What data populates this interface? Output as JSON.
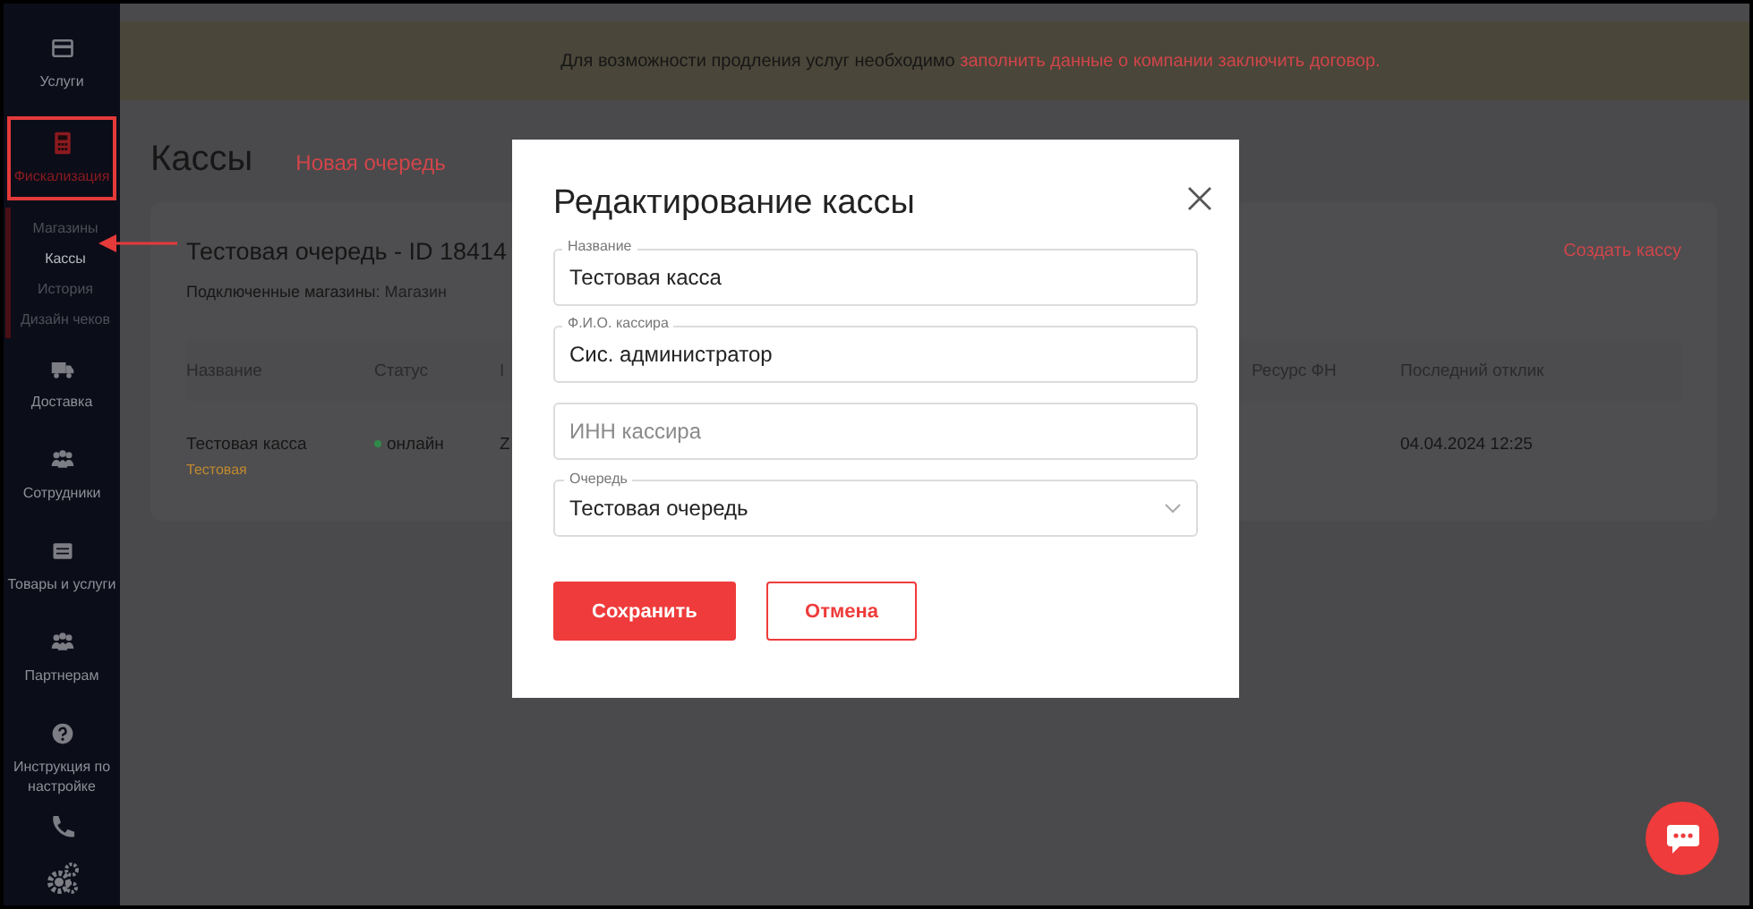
{
  "sidebar": {
    "items": [
      {
        "label": "Услуги",
        "selected": false
      },
      {
        "label": "Фискализация",
        "selected": true,
        "children": [
          {
            "label": "Магазины",
            "selected": false
          },
          {
            "label": "Кассы",
            "selected": true
          },
          {
            "label": "История",
            "selected": false
          },
          {
            "label": "Дизайн чеков",
            "selected": false
          }
        ]
      },
      {
        "label": "Доставка",
        "selected": false
      },
      {
        "label": "Сотрудники",
        "selected": false
      },
      {
        "label": "Товары и услуги",
        "selected": false
      },
      {
        "label": "Партнерам",
        "selected": false
      },
      {
        "label": "Инструкция по настройке",
        "selected": false
      }
    ]
  },
  "banner": {
    "text": "Для возможности продления услуг необходимо ",
    "link": "заполнить данные о компании заключить договор."
  },
  "page": {
    "title": "Кассы",
    "new_queue_link": "Новая очередь"
  },
  "queue": {
    "title": "Тестовая очередь - ID 18414",
    "stores_label": "Подключенные магазины:",
    "stores_value": "Магазин",
    "create_button": "Создать кассу",
    "table": {
      "columns": [
        "Название",
        "Статус",
        "I",
        "Ресурс ФН",
        "Последний отклик"
      ],
      "rows": [
        {
          "name": "Тестовая касса",
          "tag": "Тестовая",
          "status": "онлайн",
          "online": true,
          "column_3": "Z",
          "last_response": "04.04.2024 12:25"
        }
      ]
    }
  },
  "modal": {
    "title": "Редактирование кассы",
    "fields": [
      {
        "kind": "text",
        "label": "Название",
        "value": "Тестовая касса"
      },
      {
        "kind": "text",
        "label": "Ф.И.О. кассира",
        "value": "Сис. администратор"
      },
      {
        "kind": "text",
        "placeholder": "ИНН кассира"
      },
      {
        "kind": "select",
        "label": "Очередь",
        "value": "Тестовая очередь"
      }
    ],
    "buttons": [
      {
        "kind": "primary",
        "label": "Сохранить"
      },
      {
        "kind": "secondary",
        "label": "Отмена"
      }
    ]
  }
}
